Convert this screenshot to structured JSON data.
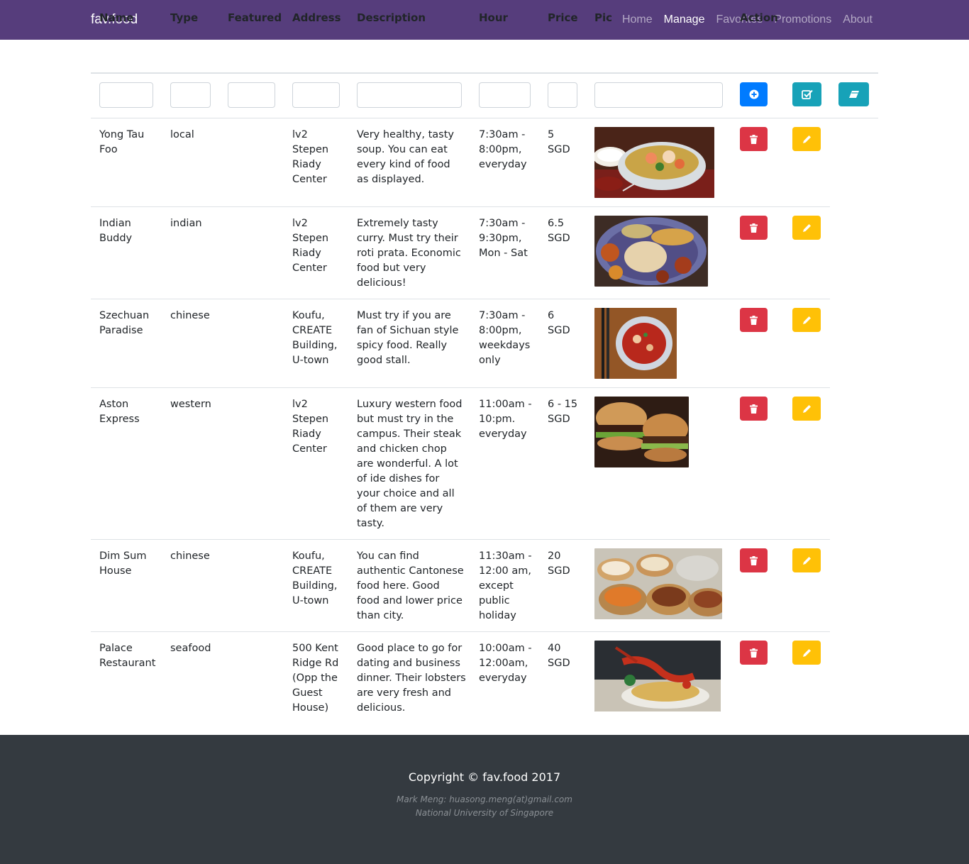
{
  "navbar": {
    "brand": "fav.food",
    "links": [
      "Home",
      "Manage",
      "Favorites",
      "Promotions",
      "About"
    ],
    "active": "Manage",
    "color": "#563d7c"
  },
  "table": {
    "headers": [
      "Name",
      "Type",
      "Featured",
      "Address",
      "Description",
      "Hour",
      "Price",
      "Pic",
      "Action"
    ],
    "rows": [
      {
        "name": "Yong Tau Foo",
        "type": "local",
        "featured": "",
        "address": "lv2 Stepen Riady Center",
        "description": "Very healthy, tasty soup. You can eat every kind of food as displayed.",
        "hour": "7:30am - 8:00pm, everyday",
        "price": "5 SGD",
        "pic": "yong-tau-foo-photo"
      },
      {
        "name": "Indian Buddy",
        "type": "indian",
        "featured": "",
        "address": "lv2 Stepen Riady Center",
        "description": "Extremely tasty curry. Must try their roti prata. Economic food but very delicious!",
        "hour": "7:30am - 9:30pm, Mon - Sat",
        "price": "6.5 SGD",
        "pic": "indian-buddy-photo"
      },
      {
        "name": "Szechuan Paradise",
        "type": "chinese",
        "featured": "",
        "address": "Koufu, CREATE Building, U-town",
        "description": "Must try if you are fan of Sichuan style spicy food. Really good stall.",
        "hour": "7:30am - 8:00pm, weekdays only",
        "price": "6 SGD",
        "pic": "szechuan-paradise-photo"
      },
      {
        "name": "Aston Express",
        "type": "western",
        "featured": "",
        "address": "lv2 Stepen Riady Center",
        "description": "Luxury western food but must try in the campus. Their steak and chicken chop are wonderful. A lot of ide dishes for your choice and all of them are very tasty.",
        "hour": "11:00am - 10:pm. everyday",
        "price": "6 - 15 SGD",
        "pic": "aston-express-photo"
      },
      {
        "name": "Dim Sum House",
        "type": "chinese",
        "featured": "",
        "address": "Koufu, CREATE Building, U-town",
        "description": "You can find authentic Cantonese food here. Good food and lower price than city.",
        "hour": "11:30am - 12:00 am, except public holiday",
        "price": "20 SGD",
        "pic": "dim-sum-house-photo"
      },
      {
        "name": "Palace Restaurant",
        "type": "seafood",
        "featured": "",
        "address": "500 Kent Ridge Rd (Opp the Guest House)",
        "description": "Good place to go for dating and business dinner. Their lobsters are very fresh and delicious.",
        "hour": "10:00am - 12:00am, everyday",
        "price": "40 SGD",
        "pic": "palace-restaurant-photo"
      }
    ]
  },
  "colors": {
    "add": "#007bff",
    "info": "#17a2b8",
    "delete": "#dc3545",
    "edit": "#ffc107",
    "footer": "#343a40"
  },
  "footer": {
    "copyright": "Copyright © fav.food 2017",
    "author": "Mark Meng: huasong.meng(at)gmail.com",
    "institution": "National University of Singapore"
  }
}
